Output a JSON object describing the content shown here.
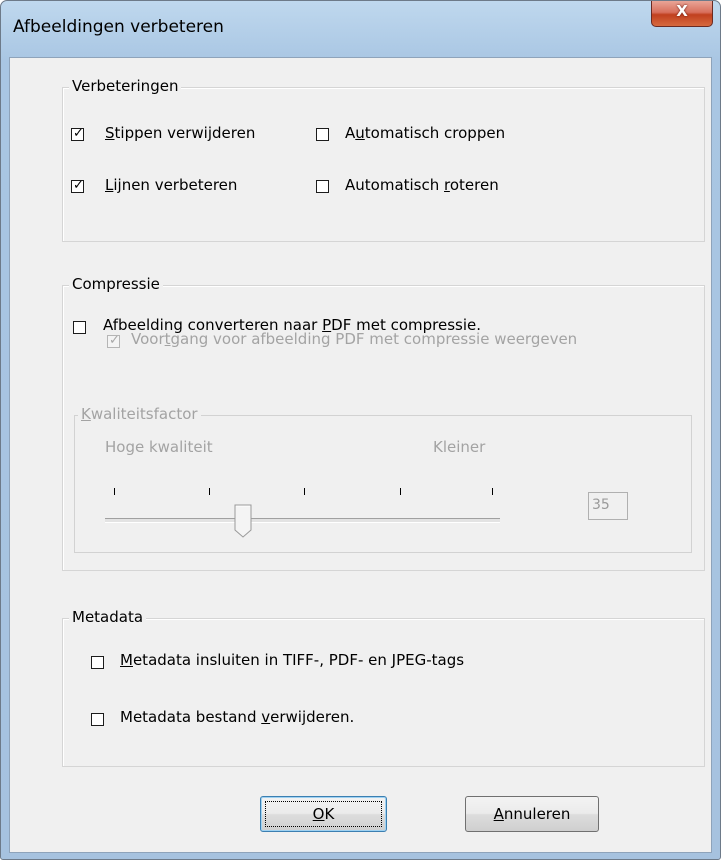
{
  "window": {
    "title": "Afbeeldingen verbeteren",
    "close_icon": "close-icon",
    "close_glyph": "X"
  },
  "verbeteringen": {
    "legend": "Verbeteringen",
    "checkboxes": [
      {
        "accel": "S",
        "rest": "tippen verwijderen",
        "checked": true
      },
      {
        "before": "A",
        "accel": "u",
        "rest": "tomatisch croppen",
        "checked": false
      },
      {
        "accel": "L",
        "rest": "ijnen verbeteren",
        "checked": true
      },
      {
        "before": "Automatisch ",
        "accel": "r",
        "rest": "oteren",
        "checked": false
      }
    ]
  },
  "compressie": {
    "legend": "Compressie",
    "convert": {
      "before": "Afbeelding converteren naar ",
      "accel": "P",
      "rest": "DF met compressie.",
      "checked": false
    },
    "progress": {
      "before": "Voor",
      "accel": "t",
      "rest": "gang voor afbeelding PDF met compressie weergeven",
      "checked": true,
      "disabled": true
    },
    "quality": {
      "legend_accel": "K",
      "legend_rest": "waliteitsfactor",
      "left_label": "Hoge kwaliteit",
      "right_label": "Kleiner",
      "slider_value": 35,
      "slider_value_text": "35",
      "slider_min_label": "Hoge kwaliteit",
      "slider_max_label": "Kleiner"
    }
  },
  "metadata": {
    "legend": "Metadata",
    "embed": {
      "accel": "M",
      "rest": "etadata insluiten in TIFF-, PDF- en JPEG-tags",
      "checked": false
    },
    "delete": {
      "before": "Metadata bestand ",
      "accel": "v",
      "rest": "erwijderen.",
      "checked": false
    }
  },
  "buttons": {
    "ok": {
      "accel": "O",
      "rest": "K"
    },
    "cancel": {
      "accel": "A",
      "rest": "nnuleren"
    }
  },
  "colors": {
    "titlebar": "#bfd8ee",
    "close_button": "#c1401f",
    "dialog_bg": "#f0f0f0",
    "disabled_text": "#a3a3a3"
  }
}
